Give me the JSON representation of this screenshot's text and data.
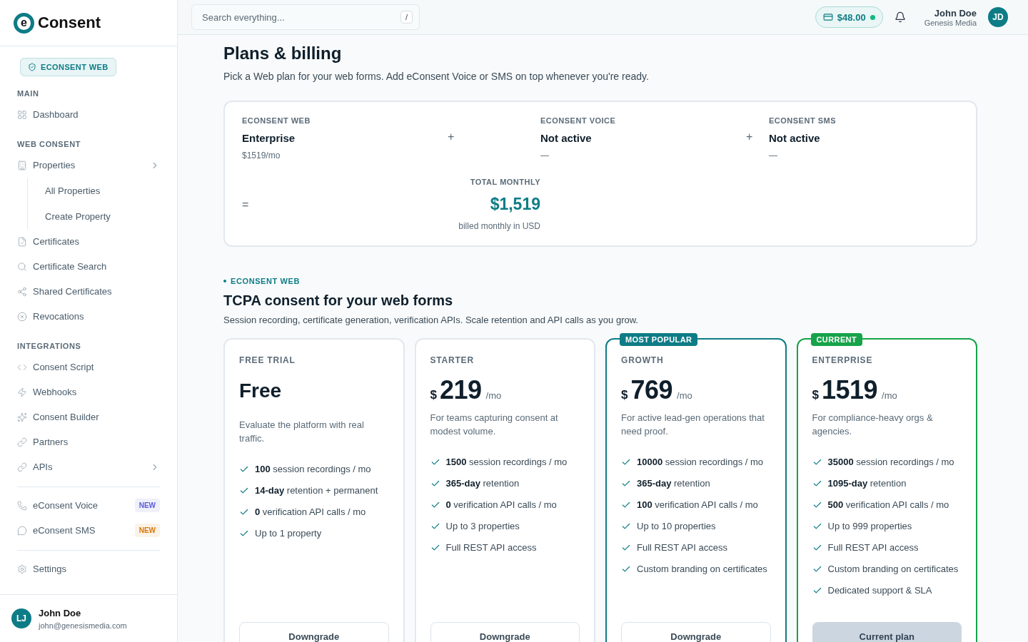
{
  "sidebar": {
    "logo": {
      "mark": "e",
      "text": "Consent"
    },
    "product_badge": "ECONSENT WEB",
    "sections": [
      {
        "title": "MAIN",
        "items": [
          {
            "label": "Dashboard"
          }
        ]
      },
      {
        "title": "WEB CONSENT",
        "items": [
          {
            "label": "Properties",
            "kind": "group",
            "children": [
              {
                "label": "All Properties"
              },
              {
                "label": "Create Property"
              }
            ]
          },
          {
            "label": "Certificates"
          },
          {
            "label": "Certificate Search"
          },
          {
            "label": "Shared Certificates"
          },
          {
            "label": "Revocations"
          }
        ]
      },
      {
        "title": "INTEGRATIONS",
        "items": [
          {
            "label": "Consent Script"
          },
          {
            "label": "Webhooks"
          },
          {
            "label": "Consent Builder"
          },
          {
            "label": "Partners"
          },
          {
            "label": "APIs",
            "kind": "group"
          }
        ]
      },
      {
        "items": [
          {
            "label": "eConsent Voice",
            "badge": {
              "text": "NEW",
              "color": "#5b5bd6"
            }
          },
          {
            "label": "eConsent SMS",
            "badge": {
              "text": "NEW",
              "color": "#d97706"
            }
          }
        ]
      },
      {
        "items": [
          {
            "label": "Settings"
          }
        ]
      }
    ],
    "user": {
      "initials": "LJ",
      "name": "John Doe",
      "email": "john@genesismedia.com"
    }
  },
  "topbar": {
    "search": {
      "placeholder": "Search everything...",
      "shortcut": "/"
    },
    "balance": "$48.00",
    "user": {
      "name": "John Doe",
      "company": "Genesis Media",
      "initials": "JD"
    }
  },
  "page": {
    "title": "Plans & billing",
    "subtitle": "Pick a Web plan for your web forms. Add eConsent Voice or SMS on top whenever you're ready."
  },
  "summary": {
    "products": [
      {
        "label": "ECONSENT WEB",
        "value": "Enterprise",
        "detail": "$1519/mo",
        "operator": "+"
      },
      {
        "label": "ECONSENT VOICE",
        "value": "Not active",
        "detail": "—",
        "operator": "+"
      },
      {
        "label": "ECONSENT SMS",
        "value": "Not active",
        "detail": "—"
      }
    ],
    "total": {
      "operator": "=",
      "label": "TOTAL MONTHLY",
      "amount": "$1,519",
      "note": "billed monthly in USD"
    }
  },
  "section": {
    "eyebrow": "ECONSENT WEB",
    "title": "TCPA consent for your web forms",
    "subtitle": "Session recording, certificate generation, verification APIs. Scale retention and API calls as you grow."
  },
  "plans": [
    {
      "tier": "FREE TRIAL",
      "price": {
        "amount": "Free"
      },
      "description": "Evaluate the platform with real traffic.",
      "features": [
        "**100** session recordings / mo",
        "**14-day** retention + permanent",
        "**0** verification API calls / mo",
        "Up to 1 property"
      ],
      "button": {
        "label": "Downgrade",
        "kind": "secondary"
      }
    },
    {
      "tier": "STARTER",
      "price": {
        "currency": "$",
        "amount": "219",
        "period": "/mo"
      },
      "description": "For teams capturing consent at modest volume.",
      "features": [
        "**1500** session recordings / mo",
        "**365-day** retention",
        "**0** verification API calls / mo",
        "Up to 3 properties",
        "Full REST API access"
      ],
      "button": {
        "label": "Downgrade",
        "kind": "secondary"
      }
    },
    {
      "tier": "GROWTH",
      "badge": {
        "text": "MOST POPULAR",
        "kind": "popular"
      },
      "price": {
        "currency": "$",
        "amount": "769",
        "period": "/mo"
      },
      "description": "For active lead-gen operations that need proof.",
      "features": [
        "**10000** session recordings / mo",
        "**365-day** retention",
        "**100** verification API calls / mo",
        "Up to 10 properties",
        "Full REST API access",
        "Custom branding on certificates"
      ],
      "button": {
        "label": "Downgrade",
        "kind": "secondary"
      }
    },
    {
      "tier": "ENTERPRISE",
      "badge": {
        "text": "CURRENT",
        "kind": "current"
      },
      "price": {
        "currency": "$",
        "amount": "1519",
        "period": "/mo"
      },
      "description": "For compliance-heavy orgs & agencies.",
      "features": [
        "**35000** session recordings / mo",
        "**1095-day** retention",
        "**500** verification API calls / mo",
        "Up to 999 properties",
        "Full REST API access",
        "Custom branding on certificates",
        "Dedicated support & SLA"
      ],
      "button": {
        "label": "Current plan",
        "kind": "current"
      }
    }
  ]
}
